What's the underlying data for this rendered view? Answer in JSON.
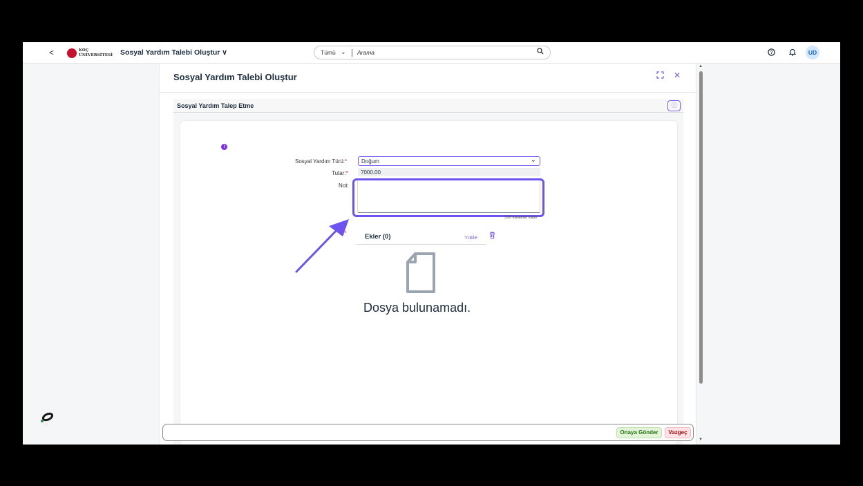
{
  "shell": {
    "back_glyph": "<",
    "logo_line1": "KOÇ",
    "logo_line2": "ÜNİVERSİTESİ",
    "app_title": "Sosyal Yardım Talebi Oluştur",
    "app_title_chevron": "∨",
    "search": {
      "scope": "Tümü",
      "placeholder": "Arama"
    },
    "avatar_initials": "UD",
    "icons": [
      "back-icon",
      "koc-logo",
      "chevron-down-icon",
      "search-icon",
      "help-icon",
      "notification-bell-icon"
    ]
  },
  "dialog": {
    "title": "Sosyal Yardım Talebi Oluştur",
    "section_title": "Sosyal Yardım Talep Etme",
    "form": {
      "type_label": "Sosyal Yardım Türü:",
      "type_value": "Doğum",
      "amount_label": "Tutar:",
      "amount_value": "7000.00",
      "note_label": "Not:",
      "note_value": "",
      "char_counter": "500 karakter kaldı",
      "attachments_label_partial": "k:",
      "required_marker": "*"
    },
    "attachments": {
      "title": "Ekler (0)",
      "upload_label": "Yükle",
      "empty_text": "Dosya bulunamadı."
    },
    "footer": {
      "submit_label": "Onaya Gönder",
      "cancel_label": "Vazgeç"
    }
  },
  "colors": {
    "accent": "#7b5cf0",
    "highlight": "#6e53f0",
    "required": "#d0102e",
    "approve_bg": "#e3f5d8",
    "cancel_bg": "#ffe3e6"
  }
}
